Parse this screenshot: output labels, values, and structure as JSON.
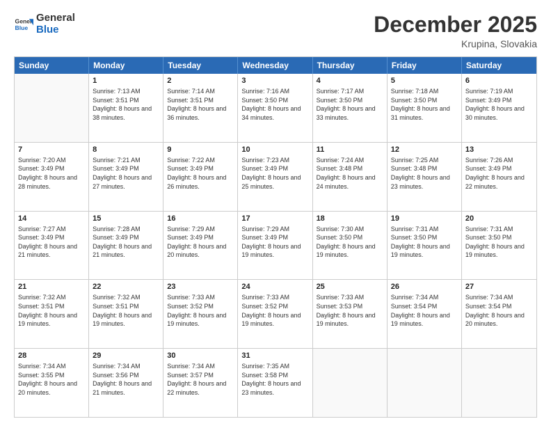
{
  "logo": {
    "text_general": "General",
    "text_blue": "Blue"
  },
  "header": {
    "title": "December 2025",
    "location": "Krupina, Slovakia"
  },
  "days_of_week": [
    "Sunday",
    "Monday",
    "Tuesday",
    "Wednesday",
    "Thursday",
    "Friday",
    "Saturday"
  ],
  "weeks": [
    [
      {
        "day": "",
        "sunrise": "",
        "sunset": "",
        "daylight": "",
        "empty": true
      },
      {
        "day": "1",
        "sunrise": "Sunrise: 7:13 AM",
        "sunset": "Sunset: 3:51 PM",
        "daylight": "Daylight: 8 hours and 38 minutes."
      },
      {
        "day": "2",
        "sunrise": "Sunrise: 7:14 AM",
        "sunset": "Sunset: 3:51 PM",
        "daylight": "Daylight: 8 hours and 36 minutes."
      },
      {
        "day": "3",
        "sunrise": "Sunrise: 7:16 AM",
        "sunset": "Sunset: 3:50 PM",
        "daylight": "Daylight: 8 hours and 34 minutes."
      },
      {
        "day": "4",
        "sunrise": "Sunrise: 7:17 AM",
        "sunset": "Sunset: 3:50 PM",
        "daylight": "Daylight: 8 hours and 33 minutes."
      },
      {
        "day": "5",
        "sunrise": "Sunrise: 7:18 AM",
        "sunset": "Sunset: 3:50 PM",
        "daylight": "Daylight: 8 hours and 31 minutes."
      },
      {
        "day": "6",
        "sunrise": "Sunrise: 7:19 AM",
        "sunset": "Sunset: 3:49 PM",
        "daylight": "Daylight: 8 hours and 30 minutes."
      }
    ],
    [
      {
        "day": "7",
        "sunrise": "Sunrise: 7:20 AM",
        "sunset": "Sunset: 3:49 PM",
        "daylight": "Daylight: 8 hours and 28 minutes."
      },
      {
        "day": "8",
        "sunrise": "Sunrise: 7:21 AM",
        "sunset": "Sunset: 3:49 PM",
        "daylight": "Daylight: 8 hours and 27 minutes."
      },
      {
        "day": "9",
        "sunrise": "Sunrise: 7:22 AM",
        "sunset": "Sunset: 3:49 PM",
        "daylight": "Daylight: 8 hours and 26 minutes."
      },
      {
        "day": "10",
        "sunrise": "Sunrise: 7:23 AM",
        "sunset": "Sunset: 3:49 PM",
        "daylight": "Daylight: 8 hours and 25 minutes."
      },
      {
        "day": "11",
        "sunrise": "Sunrise: 7:24 AM",
        "sunset": "Sunset: 3:48 PM",
        "daylight": "Daylight: 8 hours and 24 minutes."
      },
      {
        "day": "12",
        "sunrise": "Sunrise: 7:25 AM",
        "sunset": "Sunset: 3:48 PM",
        "daylight": "Daylight: 8 hours and 23 minutes."
      },
      {
        "day": "13",
        "sunrise": "Sunrise: 7:26 AM",
        "sunset": "Sunset: 3:49 PM",
        "daylight": "Daylight: 8 hours and 22 minutes."
      }
    ],
    [
      {
        "day": "14",
        "sunrise": "Sunrise: 7:27 AM",
        "sunset": "Sunset: 3:49 PM",
        "daylight": "Daylight: 8 hours and 21 minutes."
      },
      {
        "day": "15",
        "sunrise": "Sunrise: 7:28 AM",
        "sunset": "Sunset: 3:49 PM",
        "daylight": "Daylight: 8 hours and 21 minutes."
      },
      {
        "day": "16",
        "sunrise": "Sunrise: 7:29 AM",
        "sunset": "Sunset: 3:49 PM",
        "daylight": "Daylight: 8 hours and 20 minutes."
      },
      {
        "day": "17",
        "sunrise": "Sunrise: 7:29 AM",
        "sunset": "Sunset: 3:49 PM",
        "daylight": "Daylight: 8 hours and 19 minutes."
      },
      {
        "day": "18",
        "sunrise": "Sunrise: 7:30 AM",
        "sunset": "Sunset: 3:50 PM",
        "daylight": "Daylight: 8 hours and 19 minutes."
      },
      {
        "day": "19",
        "sunrise": "Sunrise: 7:31 AM",
        "sunset": "Sunset: 3:50 PM",
        "daylight": "Daylight: 8 hours and 19 minutes."
      },
      {
        "day": "20",
        "sunrise": "Sunrise: 7:31 AM",
        "sunset": "Sunset: 3:50 PM",
        "daylight": "Daylight: 8 hours and 19 minutes."
      }
    ],
    [
      {
        "day": "21",
        "sunrise": "Sunrise: 7:32 AM",
        "sunset": "Sunset: 3:51 PM",
        "daylight": "Daylight: 8 hours and 19 minutes."
      },
      {
        "day": "22",
        "sunrise": "Sunrise: 7:32 AM",
        "sunset": "Sunset: 3:51 PM",
        "daylight": "Daylight: 8 hours and 19 minutes."
      },
      {
        "day": "23",
        "sunrise": "Sunrise: 7:33 AM",
        "sunset": "Sunset: 3:52 PM",
        "daylight": "Daylight: 8 hours and 19 minutes."
      },
      {
        "day": "24",
        "sunrise": "Sunrise: 7:33 AM",
        "sunset": "Sunset: 3:52 PM",
        "daylight": "Daylight: 8 hours and 19 minutes."
      },
      {
        "day": "25",
        "sunrise": "Sunrise: 7:33 AM",
        "sunset": "Sunset: 3:53 PM",
        "daylight": "Daylight: 8 hours and 19 minutes."
      },
      {
        "day": "26",
        "sunrise": "Sunrise: 7:34 AM",
        "sunset": "Sunset: 3:54 PM",
        "daylight": "Daylight: 8 hours and 19 minutes."
      },
      {
        "day": "27",
        "sunrise": "Sunrise: 7:34 AM",
        "sunset": "Sunset: 3:54 PM",
        "daylight": "Daylight: 8 hours and 20 minutes."
      }
    ],
    [
      {
        "day": "28",
        "sunrise": "Sunrise: 7:34 AM",
        "sunset": "Sunset: 3:55 PM",
        "daylight": "Daylight: 8 hours and 20 minutes."
      },
      {
        "day": "29",
        "sunrise": "Sunrise: 7:34 AM",
        "sunset": "Sunset: 3:56 PM",
        "daylight": "Daylight: 8 hours and 21 minutes."
      },
      {
        "day": "30",
        "sunrise": "Sunrise: 7:34 AM",
        "sunset": "Sunset: 3:57 PM",
        "daylight": "Daylight: 8 hours and 22 minutes."
      },
      {
        "day": "31",
        "sunrise": "Sunrise: 7:35 AM",
        "sunset": "Sunset: 3:58 PM",
        "daylight": "Daylight: 8 hours and 23 minutes."
      },
      {
        "day": "",
        "empty": true
      },
      {
        "day": "",
        "empty": true
      },
      {
        "day": "",
        "empty": true
      }
    ]
  ]
}
